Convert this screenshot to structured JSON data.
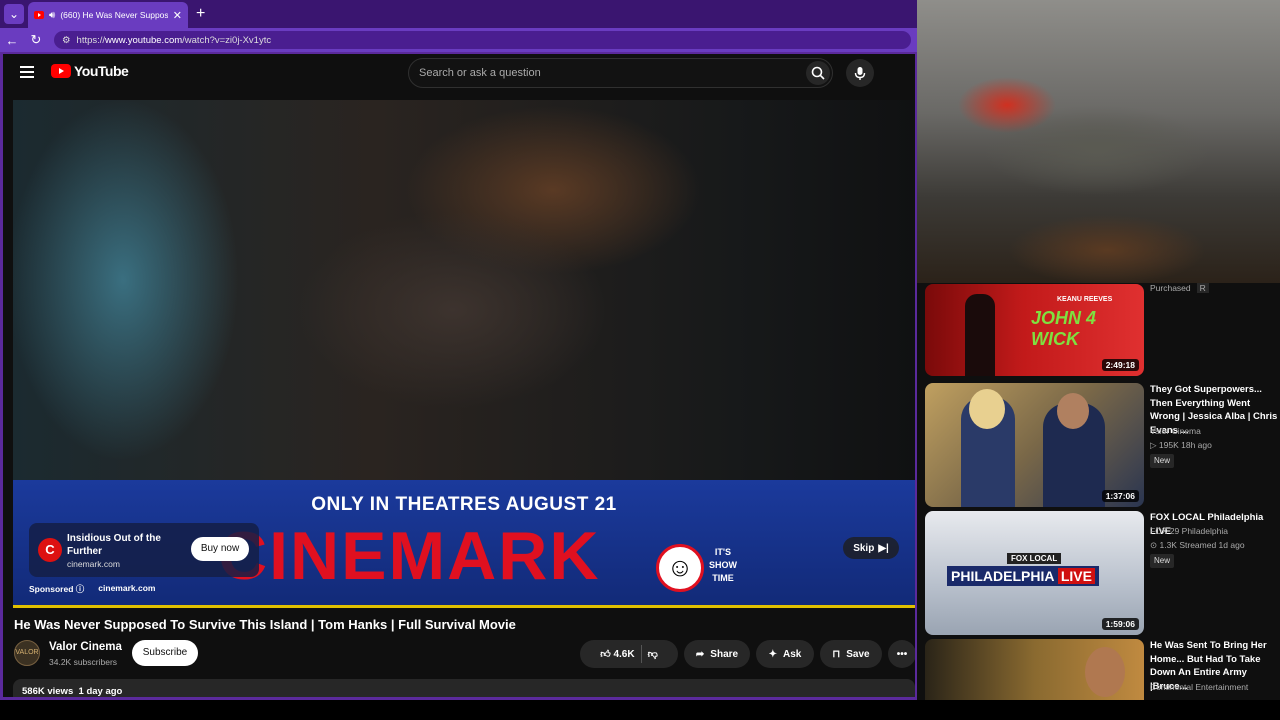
{
  "browser": {
    "tab_title": "(660) He Was Never Suppose",
    "url_prefix": "https://",
    "url_host": "www.youtube.com",
    "url_path": "/watch?v=zi0j-Xv1ytc",
    "new_tab": "+",
    "close": "✕"
  },
  "youtube": {
    "logo_text": "YouTube",
    "search_placeholder": "Search or ask a question"
  },
  "ad": {
    "headline": "ONLY IN THEATRES AUGUST 21",
    "brand": "CINEMARK",
    "tagline_1": "IT'S",
    "tagline_2": "SHOW",
    "tagline_3": "TIME",
    "card_title": "Insidious Out of the Further",
    "card_domain": "cinemark.com",
    "buy_label": "Buy now",
    "sponsored": "Sponsored",
    "footer_domain": "cinemark.com",
    "skip_label": "Skip"
  },
  "video": {
    "title": "He Was Never Supposed To Survive This Island | Tom Hanks | Full Survival Movie",
    "channel": "Valor Cinema",
    "subscribers": "34.2K subscribers",
    "subscribe_label": "Subscribe",
    "likes": "4.6K",
    "share_label": "Share",
    "ask_label": "Ask",
    "save_label": "Save",
    "views": "586K views",
    "age": "1 day ago"
  },
  "sidebar": {
    "purchased": "Purchased",
    "rating": "R",
    "items": [
      {
        "duration": "2:49:18",
        "thumb_text": "JOHN 4 WICK",
        "thumb_sub": "KEANU REEVES"
      },
      {
        "duration": "1:37:06",
        "title": "They Got Superpowers... Then Everything Went Wrong | Jessica Alba | Chris Evans ...",
        "channel": "Valor Cinema",
        "meta": "195K  18h ago",
        "badge": "New"
      },
      {
        "duration": "1:59:06",
        "thumb_text": "PHILADELPHIA",
        "thumb_live": "LIVE",
        "thumb_sub": "FOX LOCAL",
        "title": "FOX LOCAL Philadelphia LIVE",
        "channel": "FOX 29 Philadelphia",
        "meta": "1.3K  Streamed 1d ago",
        "badge": "New"
      },
      {
        "title": "He Was Sent To Bring Her Home... But Had To Take Down An Entire Army |Bruce...",
        "channel": "Continental Entertainment"
      }
    ]
  },
  "colors": {
    "browser_chrome": "#5b2a9c",
    "youtube_red": "#ff0000",
    "cinemark_red": "#e01020",
    "ad_blue": "#1b3a9c"
  }
}
